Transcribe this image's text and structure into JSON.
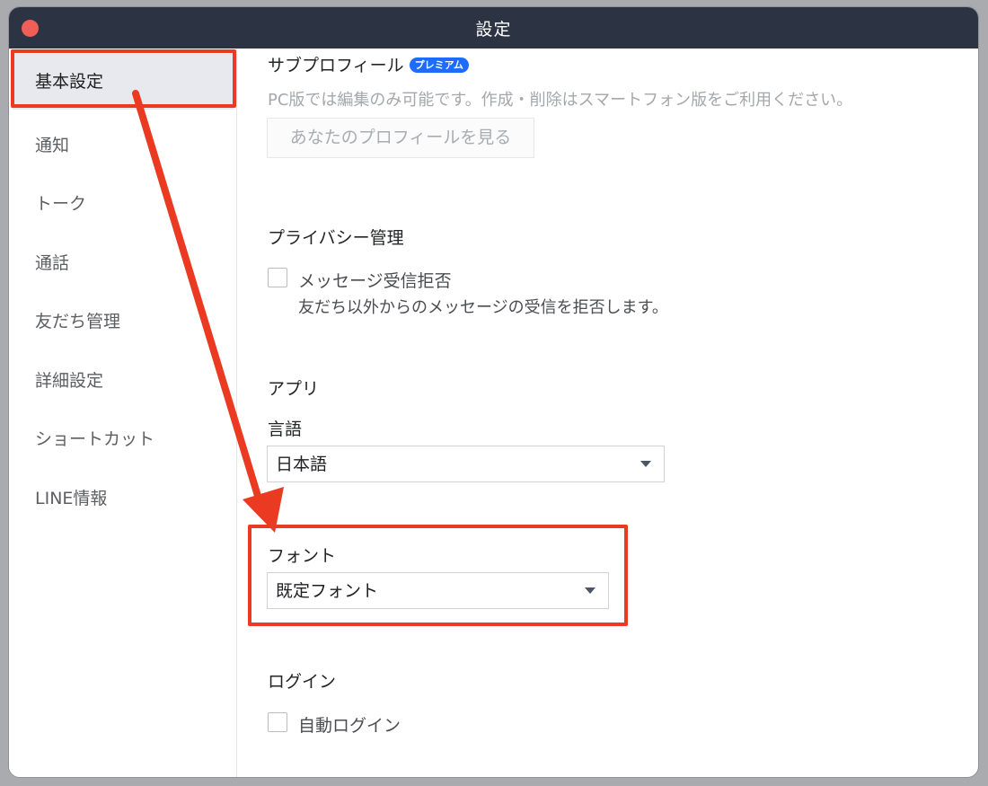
{
  "window": {
    "title": "設定"
  },
  "sidebar": {
    "items": [
      {
        "label": "基本設定",
        "active": true
      },
      {
        "label": "通知"
      },
      {
        "label": "トーク"
      },
      {
        "label": "通話"
      },
      {
        "label": "友だち管理"
      },
      {
        "label": "詳細設定"
      },
      {
        "label": "ショートカット"
      },
      {
        "label": "LINE情報"
      }
    ]
  },
  "sub_profile": {
    "title": "サブプロフィール",
    "badge": "プレミアム",
    "description": "PC版では編集のみ可能です。作成・削除はスマートフォン版をご利用ください。",
    "button_label": "あなたのプロフィールを見る"
  },
  "privacy": {
    "title": "プライバシー管理",
    "reject_messages": {
      "label": "メッセージ受信拒否",
      "description": "友だち以外からのメッセージの受信を拒否します。",
      "checked": false
    }
  },
  "app": {
    "title": "アプリ",
    "language": {
      "label": "言語",
      "selected": "日本語"
    },
    "font": {
      "label": "フォント",
      "selected": "既定フォント"
    }
  },
  "login": {
    "title": "ログイン",
    "auto_login": {
      "label": "自動ログイン",
      "checked": false
    }
  },
  "colors": {
    "titlebar": "#2c3444",
    "highlight": "#ea3a22",
    "premium_badge": "#1e6bff",
    "close_button": "#ef5f57"
  }
}
